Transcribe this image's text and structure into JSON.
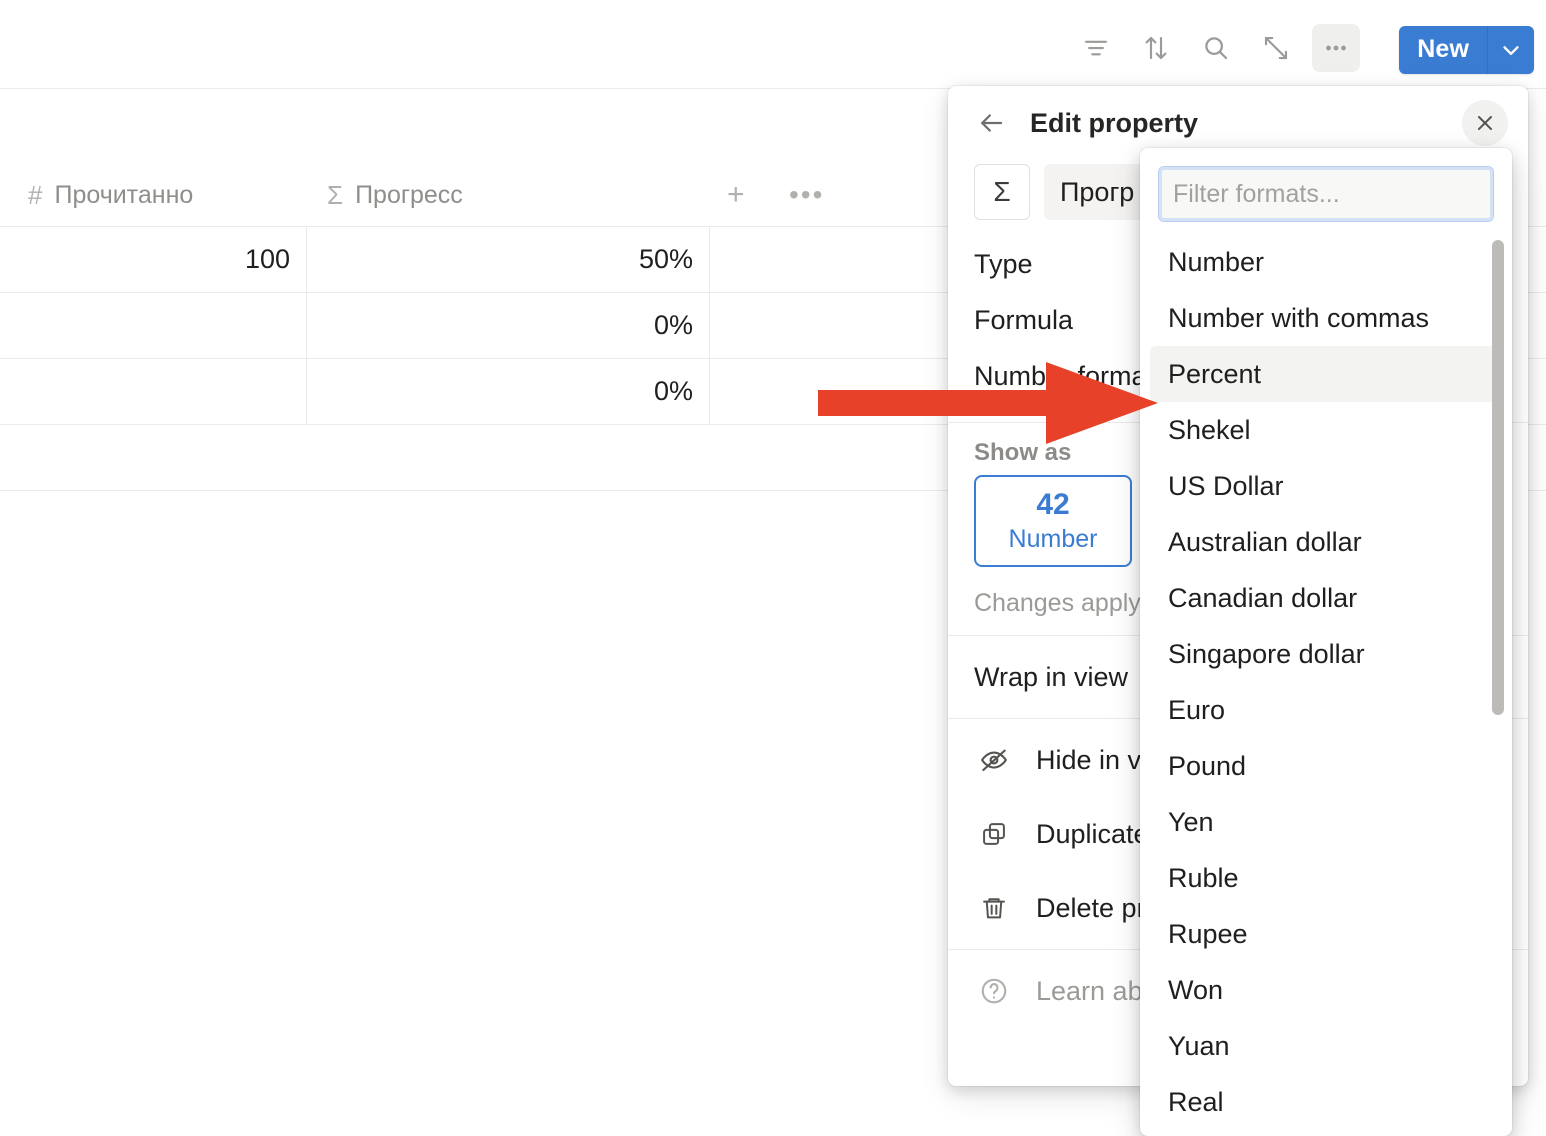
{
  "toolbar": {
    "icons": [
      {
        "name": "filter-icon",
        "label": "Filter"
      },
      {
        "name": "sort-icon",
        "label": "Sort"
      },
      {
        "name": "search-icon",
        "label": "Search"
      },
      {
        "name": "expand-icon",
        "label": "Expand"
      },
      {
        "name": "more-icon",
        "label": "More options"
      }
    ],
    "new_label": "New",
    "new_caret": "chevron-down-icon",
    "accent_color": "#3b7cd3"
  },
  "table": {
    "columns": [
      {
        "glyph": "#",
        "label": "Прочитанно"
      },
      {
        "glyph": "Σ",
        "label": "Прогресс"
      }
    ],
    "add_column_label": "+",
    "more_label": "•••",
    "rows": [
      {
        "read": "100",
        "progress": "50%"
      },
      {
        "read": "",
        "progress": "0%"
      },
      {
        "read": "",
        "progress": "0%"
      }
    ]
  },
  "panel": {
    "title": "Edit property",
    "back_icon": "arrow-left-icon",
    "close_icon": "close-icon",
    "type_glyph": "Σ",
    "property_name": "Прогр",
    "meta": [
      {
        "label": "Type"
      },
      {
        "label": "Formula"
      },
      {
        "label": "Number format"
      }
    ],
    "show_as_label": "Show as",
    "show_as_card": {
      "sample": "42",
      "name": "Number"
    },
    "hint": "Changes apply to this property.",
    "wrap_label": "Wrap in view",
    "options": [
      {
        "icon": "eye-off-icon",
        "label": "Hide in view"
      },
      {
        "icon": "duplicate-icon",
        "label": "Duplicate property"
      },
      {
        "icon": "trash-icon",
        "label": "Delete property"
      }
    ],
    "learn_more": {
      "icon": "question-circle-icon",
      "label": "Learn about properties"
    }
  },
  "format_dropdown": {
    "search_placeholder": "Filter formats...",
    "search_value": "",
    "selected": "Percent",
    "items": [
      "Number",
      "Number with commas",
      "Percent",
      "Shekel",
      "US Dollar",
      "Australian dollar",
      "Canadian dollar",
      "Singapore dollar",
      "Euro",
      "Pound",
      "Yen",
      "Ruble",
      "Rupee",
      "Won",
      "Yuan",
      "Real"
    ]
  },
  "annotation": {
    "arrow_color": "#e8412a",
    "points_to": "Percent"
  }
}
